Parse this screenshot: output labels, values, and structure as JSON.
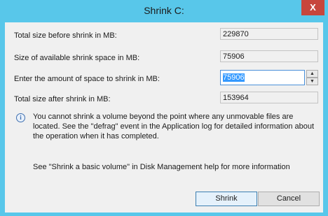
{
  "window": {
    "title": "Shrink C:",
    "close_glyph": "X"
  },
  "fields": {
    "total_before_label": "Total size before shrink in MB:",
    "total_before_value": "229870",
    "available_label": "Size of available shrink space in MB:",
    "available_value": "75906",
    "amount_label": "Enter the amount of space to shrink in MB:",
    "amount_value": "75906",
    "total_after_label": "Total size after shrink in MB:",
    "total_after_value": "153964"
  },
  "info": {
    "icon": "info-icon",
    "message": "You cannot shrink a volume beyond the point where any unmovable files are located. See the \"defrag\" event in the Application log for detailed information about the operation when it has completed.",
    "help": "See \"Shrink a basic volume\" in Disk Management help for more information"
  },
  "buttons": {
    "shrink": "Shrink",
    "cancel": "Cancel"
  },
  "spin": {
    "up_glyph": "▲",
    "down_glyph": "▼"
  },
  "colors": {
    "titlebar": "#58c7ea",
    "close_button": "#c7463c",
    "selection": "#3399ff"
  }
}
